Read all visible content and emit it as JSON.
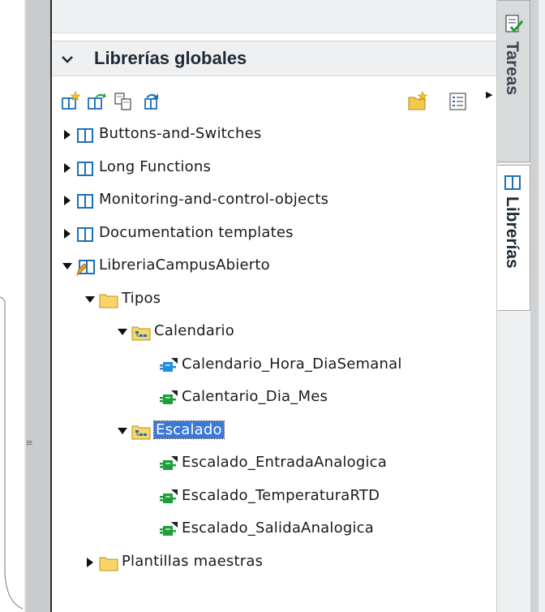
{
  "section": {
    "title": "Librerías globales"
  },
  "toolbar": {
    "buttons": [
      {
        "icon": "new-library-icon"
      },
      {
        "icon": "open-library-icon"
      },
      {
        "icon": "copy-library-icon"
      },
      {
        "icon": "update-library-icon"
      },
      {
        "icon": "new-folder-icon"
      },
      {
        "icon": "details-view-icon"
      }
    ]
  },
  "tree": {
    "items": [
      {
        "label": "Buttons-and-Switches",
        "expanded": false,
        "icon": "library-book-icon"
      },
      {
        "label": "Long Functions",
        "expanded": false,
        "icon": "library-book-icon"
      },
      {
        "label": "Monitoring-and-control-objects",
        "expanded": false,
        "icon": "library-book-icon"
      },
      {
        "label": "Documentation templates",
        "expanded": false,
        "icon": "library-book-icon"
      },
      {
        "label": "LibreriaCampusAbierto",
        "expanded": true,
        "icon": "library-book-edit-icon"
      },
      {
        "label": "Tipos",
        "expanded": true,
        "icon": "folder-icon"
      },
      {
        "label": "Calendario",
        "expanded": true,
        "icon": "type-folder-icon"
      },
      {
        "label": "Calendario_Hora_DiaSemanal",
        "icon": "block-type-blue-icon"
      },
      {
        "label": "Calentario_Dia_Mes",
        "icon": "block-type-green-icon"
      },
      {
        "label": "Escalado",
        "expanded": true,
        "icon": "type-folder-icon",
        "selected": true
      },
      {
        "label": "Escalado_EntradaAnalogica",
        "icon": "block-type-green-icon"
      },
      {
        "label": "Escalado_TemperaturaRTD",
        "icon": "block-type-green-icon"
      },
      {
        "label": "Escalado_SalidaAnalogica",
        "icon": "block-type-green-icon"
      },
      {
        "label": "Plantillas maestras",
        "expanded": false,
        "icon": "folder-icon"
      }
    ]
  },
  "side_tabs": {
    "tareas": "Tareas",
    "librerias": "Librerías"
  },
  "colors": {
    "selection": "#3c78d8",
    "panel_header": "#eff0f1",
    "folder": "#f3c94b",
    "block_blue": "#1f8fe0",
    "block_green": "#1e9e3a"
  }
}
